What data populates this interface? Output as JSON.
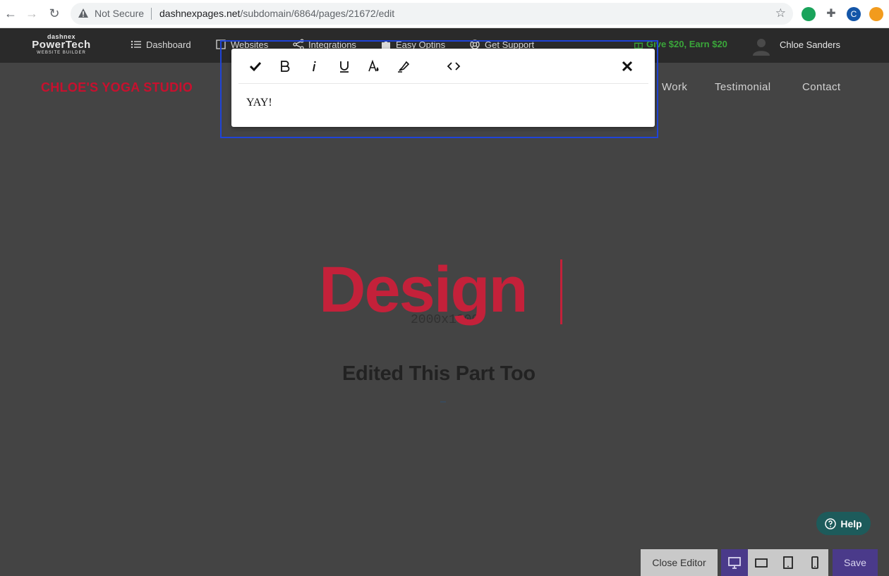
{
  "browser": {
    "security_label": "Not Secure",
    "url_host": "dashnexpages.net",
    "url_path": "/subdomain/6864/pages/21672/edit",
    "profile_initial": "C"
  },
  "app": {
    "logo": {
      "line1": "dashnex",
      "line2": "PowerTech",
      "line3": "WEBSITE BUILDER"
    },
    "nav": [
      {
        "label": "Dashboard",
        "icon": "list-icon"
      },
      {
        "label": "Websites",
        "icon": "book-icon"
      },
      {
        "label": "Integrations",
        "icon": "share-icon"
      },
      {
        "label": "Easy Optins",
        "icon": "puzzle-icon"
      },
      {
        "label": "Get Support",
        "icon": "lifebuoy-icon"
      }
    ],
    "promo": "Give $20, Earn $20",
    "user_name": "Chloe Sanders"
  },
  "page": {
    "site_title": "CHLOE'S YOGA STUDIO",
    "site_nav": [
      "Work",
      "Testimonial",
      "Contact"
    ],
    "hero_text": "Design",
    "placeholder_text": "2000x1000",
    "subheading": "Edited This Part Too"
  },
  "editor": {
    "content": "YAY!",
    "tools": [
      "check-icon",
      "bold-icon",
      "italic-icon",
      "underline-icon",
      "text-color-icon",
      "highlight-icon",
      "code-icon",
      "close-icon"
    ]
  },
  "controls": {
    "help_label": "Help",
    "close_editor_label": "Close Editor",
    "save_label": "Save",
    "active_device": "desktop"
  },
  "colors": {
    "accent_red": "#c4213a",
    "selection_blue": "#1f44d8",
    "promo_green": "#3aa63a",
    "save_purple": "#4a3a8a"
  }
}
